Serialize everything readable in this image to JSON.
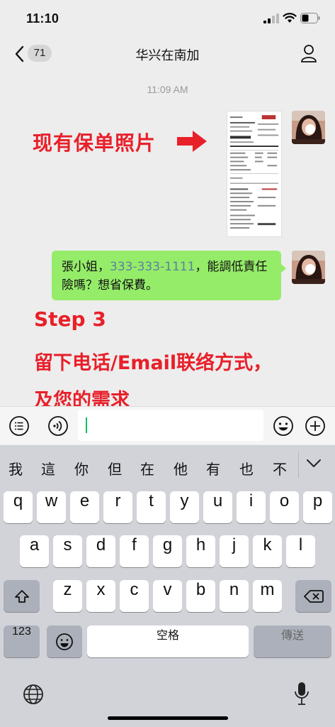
{
  "status_bar": {
    "time": "11:10"
  },
  "nav": {
    "back_count": "71",
    "title": "华兴在南加"
  },
  "chat": {
    "timestamp": "11:09 AM",
    "overlay_photo_label": "现有保单照片",
    "bubble": {
      "prefix": "張小姐，",
      "phone": "333-333-1111",
      "suffix": "，能調低責任險嗎？想省保費。"
    },
    "overlay_step": "Step 3",
    "overlay_line2": "留下电话/Email联络方式，",
    "overlay_line3": "及您的需求"
  },
  "keyboard": {
    "candidates": [
      "我",
      "這",
      "你",
      "但",
      "在",
      "他",
      "有",
      "也",
      "不"
    ],
    "row1": [
      "q",
      "w",
      "e",
      "r",
      "t",
      "y",
      "u",
      "i",
      "o",
      "p"
    ],
    "row2": [
      "a",
      "s",
      "d",
      "f",
      "g",
      "h",
      "j",
      "k",
      "l"
    ],
    "row3": [
      "z",
      "x",
      "c",
      "v",
      "b",
      "n",
      "m"
    ],
    "numbers_label": "123",
    "space_label": "空格",
    "send_label": "傳送"
  },
  "colors": {
    "accent_red": "#e8202a",
    "bubble_green": "#95ec69",
    "caret_green": "#07c160"
  },
  "icons": [
    "back-chevron-icon",
    "profile-icon",
    "voice-icon",
    "emoji-icon",
    "plus-icon",
    "shift-icon",
    "delete-icon",
    "globe-icon",
    "mic-icon"
  ]
}
